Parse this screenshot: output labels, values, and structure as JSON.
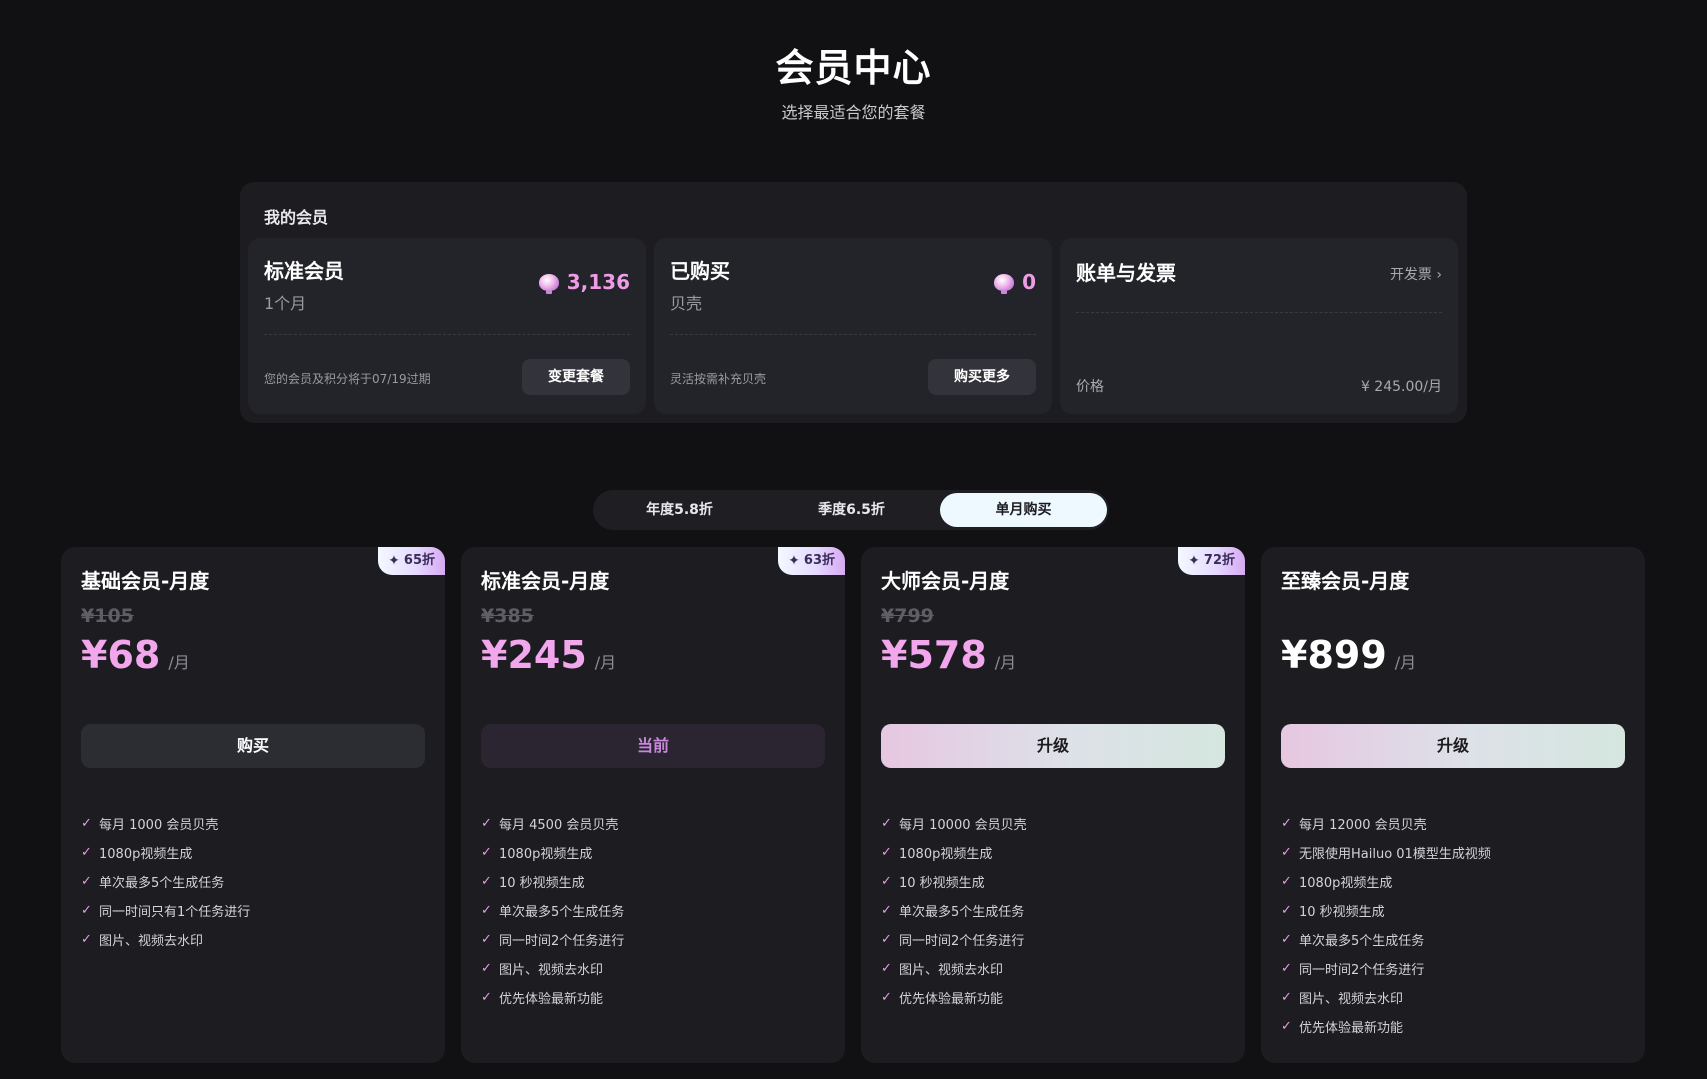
{
  "header": {
    "title": "会员中心",
    "subtitle": "选择最适合您的套餐"
  },
  "my_membership": {
    "title": "我的会员",
    "plan_card": {
      "title": "标准会员",
      "subtitle": "1个月",
      "balance": "3,136",
      "balance_icon": "shell-icon",
      "note": "您的会员及积分将于07/19过期",
      "button": "变更套餐"
    },
    "purchased_card": {
      "title": "已购买",
      "subtitle": "贝壳",
      "balance": "0",
      "balance_icon": "shell-icon",
      "note": "灵活按需补充贝壳",
      "button": "购买更多"
    },
    "billing_card": {
      "title": "账单与发票",
      "link": "开发票",
      "price_label": "价格",
      "price_value": "¥ 245.00/月"
    }
  },
  "tabs": [
    {
      "label": "年度5.8折",
      "active": false
    },
    {
      "label": "季度6.5折",
      "active": false
    },
    {
      "label": "单月购买",
      "active": true
    }
  ],
  "plans": [
    {
      "name": "基础会员-月度",
      "badge": "65折",
      "old_price": "¥105",
      "price": "¥68",
      "unit": "/月",
      "button": "购买",
      "features": [
        "每月 1000 会员贝壳",
        "1080p视频生成",
        "单次最多5个生成任务",
        "同一时间只有1个任务进行",
        "图片、视频去水印"
      ]
    },
    {
      "name": "标准会员-月度",
      "badge": "63折",
      "old_price": "¥385",
      "price": "¥245",
      "unit": "/月",
      "button": "当前",
      "features": [
        "每月 4500 会员贝壳",
        "1080p视频生成",
        "10 秒视频生成",
        "单次最多5个生成任务",
        "同一时间2个任务进行",
        "图片、视频去水印",
        "优先体验最新功能"
      ]
    },
    {
      "name": "大师会员-月度",
      "badge": "72折",
      "old_price": "¥799",
      "price": "¥578",
      "unit": "/月",
      "button": "升级",
      "features": [
        "每月 10000 会员贝壳",
        "1080p视频生成",
        "10 秒视频生成",
        "单次最多5个生成任务",
        "同一时间2个任务进行",
        "图片、视频去水印",
        "优先体验最新功能"
      ]
    },
    {
      "name": "至臻会员-月度",
      "price": "¥899",
      "unit": "/月",
      "button": "升级",
      "features": [
        "每月 12000 会员贝壳",
        "无限使用Hailuo 01模型生成视频",
        "1080p视频生成",
        "10 秒视频生成",
        "单次最多5个生成任务",
        "同一时间2个任务进行",
        "图片、视频去水印",
        "优先体验最新功能"
      ]
    }
  ],
  "colors": {
    "accent_pink": "#ef9ce7",
    "background": "#111114",
    "card": "#1c1c21"
  }
}
